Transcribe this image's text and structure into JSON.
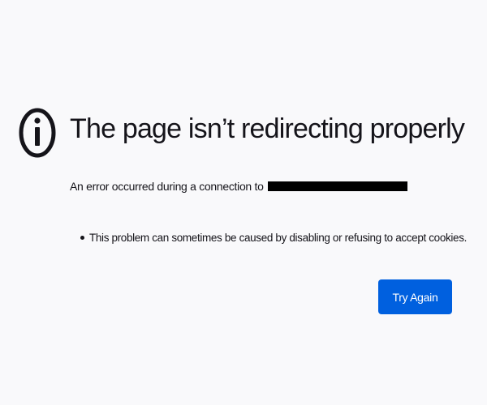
{
  "error": {
    "icon": "info-icon",
    "title": "The page isn’t redirecting properly",
    "description": "An error occurred during a connection to",
    "reasons": [
      "This problem can sometimes be caused by disabling or refusing to accept cookies."
    ]
  },
  "actions": {
    "try_again_label": "Try Again"
  },
  "colors": {
    "background": "#f9f9fb",
    "text": "#15141a",
    "primary_button": "#0060df",
    "redaction": "#000000"
  }
}
